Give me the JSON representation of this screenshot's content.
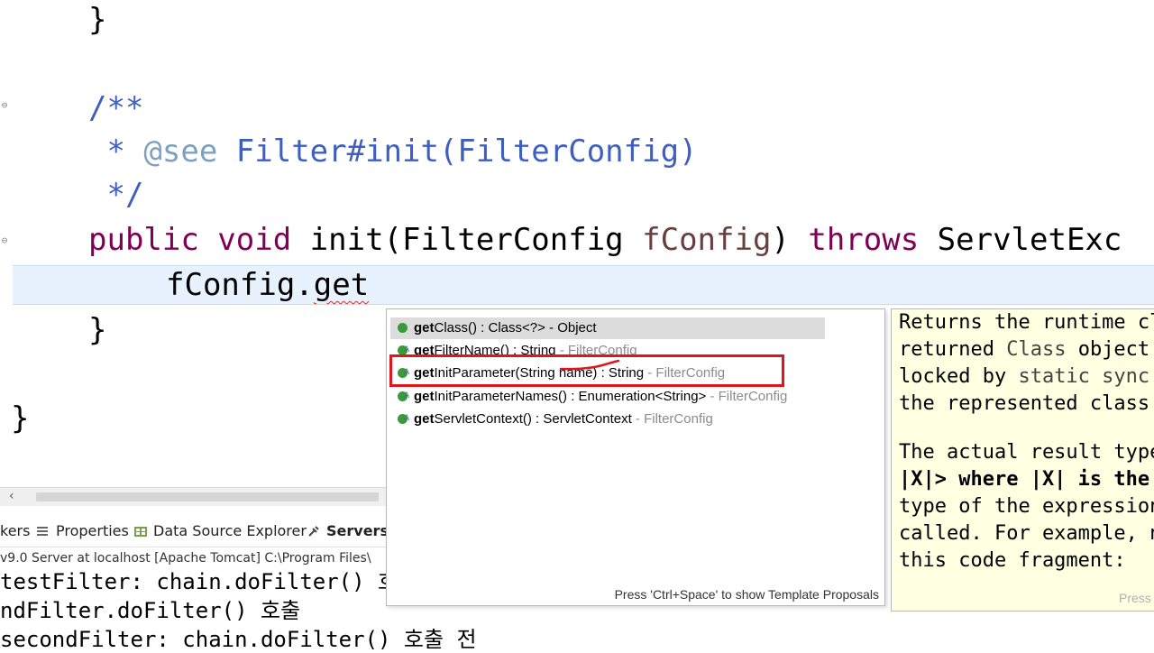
{
  "editor": {
    "lines": {
      "brace_close_1": "}",
      "doc_open": "/**",
      "doc_see_star": " * ",
      "doc_see_tag": "@see",
      "doc_see_ref": " Filter#init(FilterConfig)",
      "doc_close": " */",
      "kw_public": "public",
      "kw_void": " void",
      "method_sig": " init(FilterConfig ",
      "param_name": "fConfig",
      "paren_close": ")",
      "kw_throws": " throws",
      "exception_type": " ServletExc",
      "current_code_prefix": "fConfig.",
      "current_code_typed": "get",
      "brace_close_2": "}",
      "brace_close_3": "}"
    }
  },
  "views": {
    "tab_markers_partial": "kers",
    "tab_properties": "Properties",
    "tab_data_source_explorer": "Data Source Explorer",
    "tab_servers": "Servers",
    "console_header": "v9.0 Server at localhost [Apache Tomcat] C:\\Program Files\\",
    "console_lines": [
      "testFilter: chain.doFilter() 호출",
      "ndFilter.doFilter() 호출",
      "secondFilter: chain.doFilter() 호출 전"
    ]
  },
  "completion": {
    "proposals": [
      {
        "name_bold": "get",
        "name_rest": "Class() : Class<?>",
        "owner": " - Object"
      },
      {
        "name_bold": "get",
        "name_rest": "FilterName() : String",
        "owner": " - FilterConfig"
      },
      {
        "name_bold": "get",
        "name_rest": "InitParameter(String name) : String",
        "owner": " - FilterConfig"
      },
      {
        "name_bold": "get",
        "name_rest": "InitParameterNames() : Enumeration<String>",
        "owner": " - FilterConfig"
      },
      {
        "name_bold": "get",
        "name_rest": "ServletContext() : ServletContext",
        "owner": " - FilterConfig"
      }
    ],
    "footer": "Press 'Ctrl+Space' to show Template Proposals"
  },
  "javadoc": {
    "lines": [
      {
        "a": "Returns the runtime cla",
        "code": "",
        "b": ""
      },
      {
        "a": "returned ",
        "code": "Class",
        "b": " object"
      },
      {
        "a": "locked by ",
        "code": "static sync",
        "b": ""
      },
      {
        "a": "the represented class.",
        "code": "",
        "b": ""
      },
      {
        "a": "",
        "code": "",
        "b": ""
      },
      {
        "a": "The actual result type",
        "code": "",
        "b": ""
      },
      {
        "a": "|X|> where |X| is the",
        "code": "",
        "b": ""
      },
      {
        "a": "type of the expression",
        "code": "",
        "b": ""
      },
      {
        "a": "called. For example, no",
        "code": "",
        "b": ""
      },
      {
        "a": "this code fragment:",
        "code": "",
        "b": ""
      }
    ],
    "footer": "Press"
  },
  "colors": {
    "keyword": "#7f0055",
    "javadoc": "#3f5fbf",
    "javadoc_tag": "#7f9fbf",
    "param": "#6a3e3e",
    "highlight_box": "#e0161e",
    "hover_bg": "#ffffe1"
  }
}
